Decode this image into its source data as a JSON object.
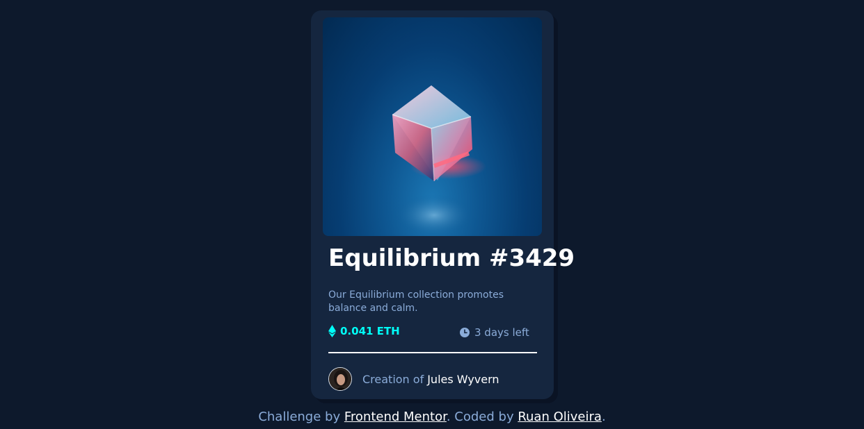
{
  "card": {
    "image_alt": "Equilibrium",
    "title": "Equilibrium #3429",
    "description": "Our Equilibrium collection promotes balance and calm.",
    "price": "0.041 ETH",
    "time_left": "3 days left",
    "creator_prefix": "Creation of",
    "creator_name": "Jules Wyvern",
    "icons": {
      "price": "ethereum-icon",
      "time": "clock-icon",
      "avatar": "avatar-image"
    }
  },
  "footer": {
    "text_1": "Challenge by",
    "link_1": "Frontend Mentor",
    "text_2": ". Coded by",
    "link_2": "Ruan Oliveira",
    "text_3": "."
  },
  "colors": {
    "background": "#0d192c",
    "card": "#15263f",
    "accent_cyan": "#00fff8",
    "soft_blue": "#8bacd9",
    "white": "#ffffff"
  }
}
